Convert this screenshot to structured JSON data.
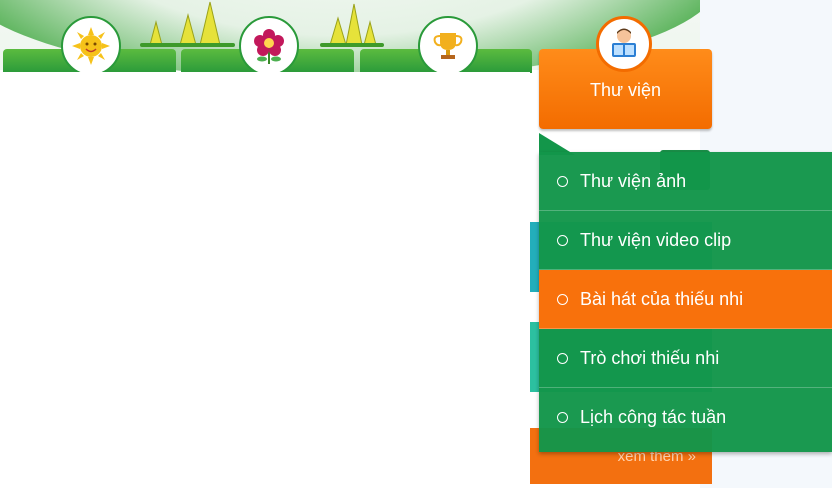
{
  "nav": {
    "tabs": [
      {
        "icon": "sun-icon"
      },
      {
        "icon": "flower-icon"
      },
      {
        "icon": "trophy-icon"
      },
      {
        "label": "Thư viện",
        "icon": "reading-child-icon",
        "active": true
      }
    ]
  },
  "dropdown": {
    "items": [
      {
        "label": "Thư viện ảnh",
        "active": false
      },
      {
        "label": "Thư viện video clip",
        "active": false
      },
      {
        "label": "Bài hát của thiếu nhi",
        "active": true
      },
      {
        "label": "Trò chơi thiếu nhi",
        "active": false
      },
      {
        "label": "Lịch công tác tuần",
        "active": false
      }
    ]
  },
  "sidebar": {
    "more_link": "xem thêm »"
  },
  "colors": {
    "green": "#13964a",
    "orange": "#f8710c",
    "tab_green": "#2a9a3a"
  }
}
